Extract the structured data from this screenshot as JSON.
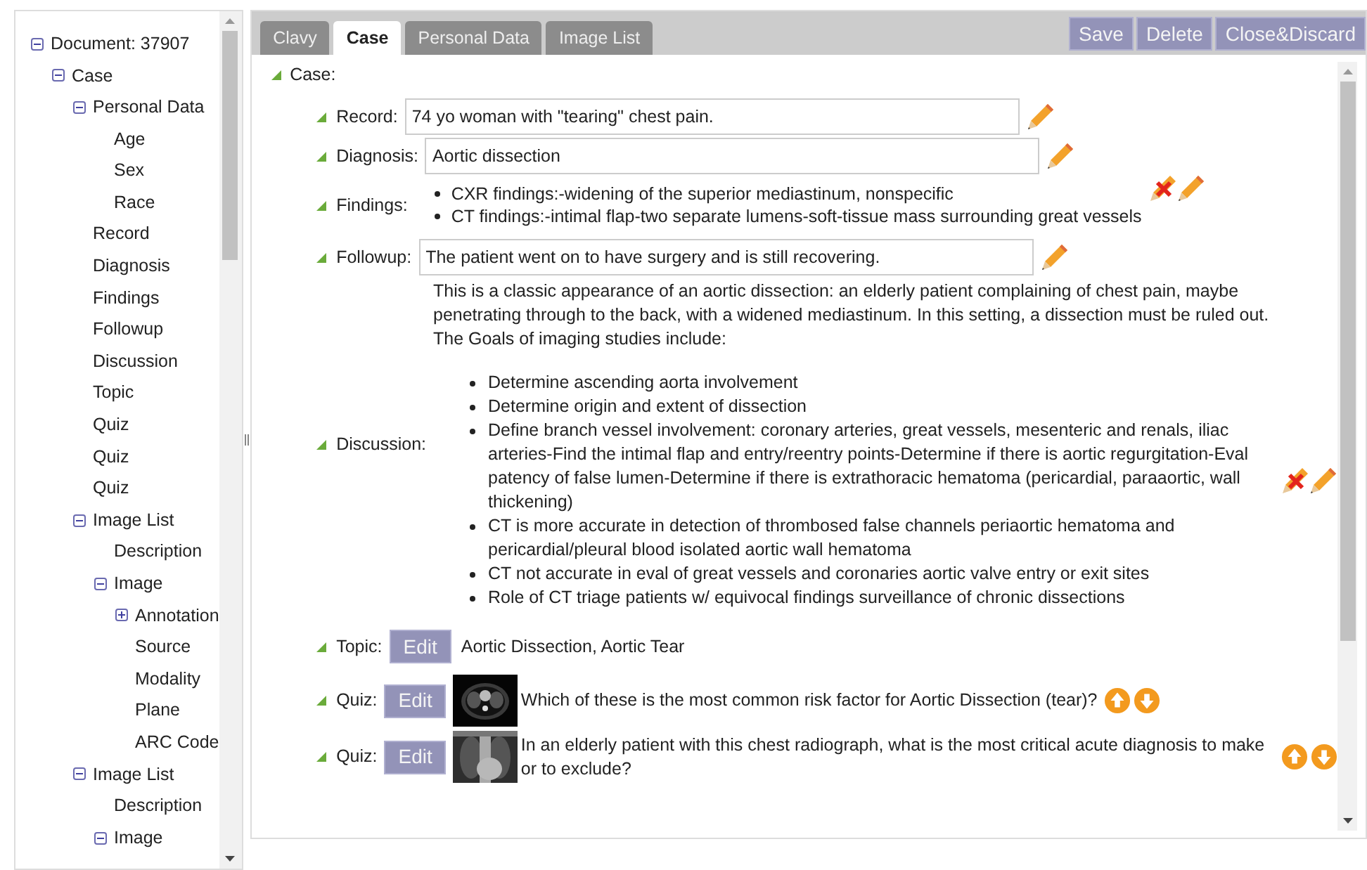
{
  "tree": {
    "label": "Document: 37907",
    "expanded": true,
    "children": [
      {
        "label": "Case",
        "expanded": true,
        "children": [
          {
            "label": "Personal Data",
            "expanded": true,
            "children": [
              {
                "label": "Age"
              },
              {
                "label": "Sex"
              },
              {
                "label": "Race"
              }
            ]
          },
          {
            "label": "Record"
          },
          {
            "label": "Diagnosis"
          },
          {
            "label": "Findings"
          },
          {
            "label": "Followup"
          },
          {
            "label": "Discussion"
          },
          {
            "label": "Topic"
          },
          {
            "label": "Quiz"
          },
          {
            "label": "Quiz"
          },
          {
            "label": "Quiz"
          },
          {
            "label": "Image List",
            "expanded": true,
            "children": [
              {
                "label": "Description"
              },
              {
                "label": "Image",
                "expanded": true,
                "children": [
                  {
                    "label": "Annotation",
                    "expanded": false
                  },
                  {
                    "label": "Source"
                  },
                  {
                    "label": "Modality"
                  },
                  {
                    "label": "Plane"
                  },
                  {
                    "label": "ARC Code"
                  }
                ]
              }
            ]
          },
          {
            "label": "Image List",
            "expanded": true,
            "children": [
              {
                "label": "Description"
              },
              {
                "label": "Image",
                "expanded": true
              }
            ]
          }
        ]
      }
    ]
  },
  "tabs": [
    {
      "label": "Clavy",
      "selected": false
    },
    {
      "label": "Case",
      "selected": true
    },
    {
      "label": "Personal Data",
      "selected": false
    },
    {
      "label": "Image List",
      "selected": false
    }
  ],
  "actions": [
    "Save",
    "Delete",
    "Close&Discard"
  ],
  "section": "Case:",
  "fields": [
    {
      "kind": "input",
      "label": "Record:",
      "value": "74 yo woman with \"tearing\" chest pain."
    },
    {
      "kind": "input",
      "label": "Diagnosis:",
      "value": "Aortic dissection"
    },
    {
      "kind": "list",
      "label": "Findings:",
      "items": [
        "CXR findings:-widening of the superior mediastinum, nonspecific",
        "CT findings:-intimal flap-two separate lumens-soft-tissue mass surrounding great vessels"
      ]
    },
    {
      "kind": "input",
      "label": "Followup:",
      "value": "The patient went on to have surgery and is still recovering."
    },
    {
      "kind": "discussion",
      "label": "Discussion:",
      "intro": "This is a classic appearance of an aortic dissection: an elderly patient complaining of chest pain, maybe penetrating through to the back, with a widened mediastinum. In this setting, a dissection must be ruled out. The Goals of imaging studies include:",
      "items": [
        "Determine ascending aorta involvement",
        "Determine origin and extent of dissection",
        "Define branch vessel involvement: coronary arteries, great vessels, mesenteric and renals, iliac arteries-Find the intimal flap and entry/reentry points-Determine if there is aortic regurgitation-Eval patency of false lumen-Determine if there is extrathoracic hematoma (pericardial, paraaortic, wall thickening)",
        "CT is more accurate in detection of thrombosed false channels periaortic hematoma and pericardial/pleural blood isolated aortic wall hematoma",
        "CT not accurate in eval of great vessels and coronaries aortic valve entry or exit sites",
        "Role of CT triage patients w/ equivocal findings surveillance of chronic dissections"
      ]
    },
    {
      "kind": "topic",
      "label": "Topic:",
      "button": "Edit",
      "value": "Aortic Dissection, Aortic Tear"
    },
    {
      "kind": "quiz",
      "label": "Quiz:",
      "button": "Edit",
      "question": "Which of these is the most common risk factor for Aortic Dissection (tear)?"
    },
    {
      "kind": "quiz",
      "label": "Quiz:",
      "button": "Edit",
      "question": "In an elderly patient with this chest radiograph, what is the most critical acute diagnosis to make or to exclude?"
    }
  ]
}
